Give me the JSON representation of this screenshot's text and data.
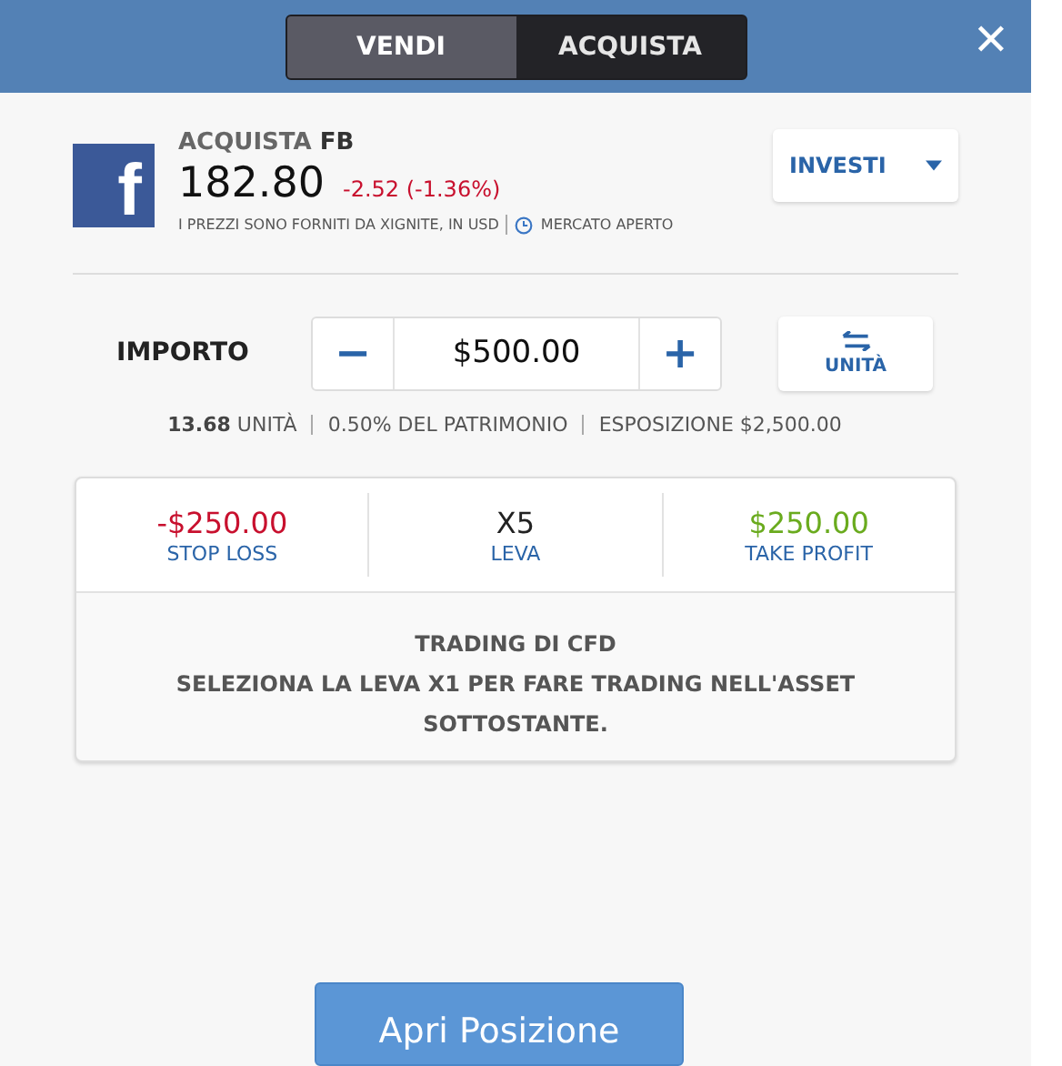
{
  "header": {
    "tabs": [
      {
        "label": "VENDI",
        "selected": true
      },
      {
        "label": "ACQUISTA",
        "selected": false
      }
    ],
    "close": "✕"
  },
  "instrument": {
    "action": "ACQUISTA",
    "symbol": "FB",
    "logo_letter": "f",
    "price": "182.80",
    "change": "-2.52 (-1.36%)",
    "source": "I PREZZI SONO FORNITI DA XIGNITE, IN USD",
    "market": "MERCATO APERTO",
    "menu_button": "INVESTI"
  },
  "amount": {
    "label": "IMPORTO",
    "minus": "−",
    "value": "$500.00",
    "plus": "+",
    "units_button": "UNITÀ",
    "units": "13.68",
    "units_label": "UNITÀ",
    "equity": "0.50% DEL PATRIMONIO",
    "exposure": "ESPOSIZIONE $2,500.00"
  },
  "settings": [
    {
      "value": "-$250.00",
      "label": "STOP LOSS",
      "color": "#c8102e"
    },
    {
      "value": "X5",
      "label": "LEVA",
      "color": "#222222"
    },
    {
      "value": "$250.00",
      "label": "TAKE PROFIT",
      "color": "#6aab1e"
    }
  ],
  "notice": {
    "title": "TRADING DI CFD",
    "text": "SELEZIONA LA LEVA X1 PER FARE TRADING NELL'ASSET SOTTOSTANTE."
  },
  "submit": "Apri Posizione"
}
